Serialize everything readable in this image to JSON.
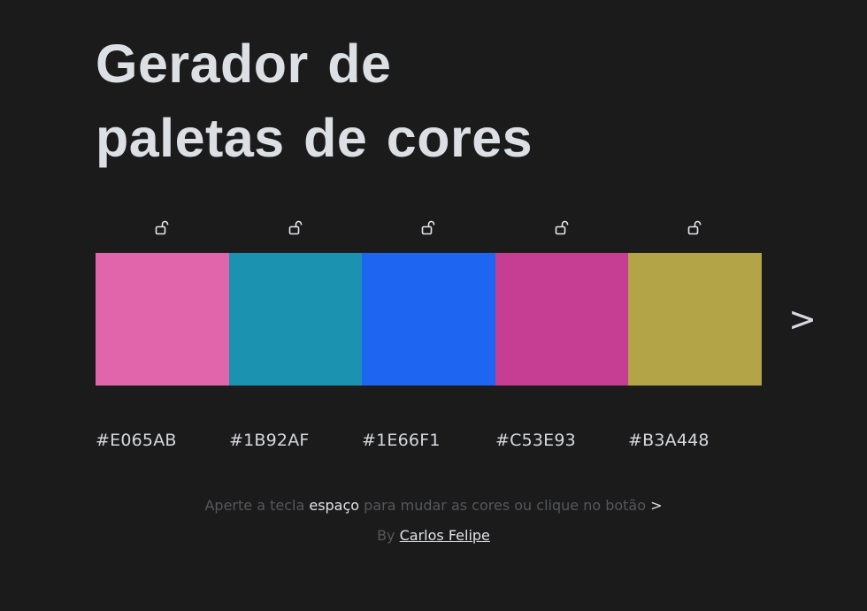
{
  "header": {
    "title_line1": "Gerador de",
    "title_line2": "paletas de cores"
  },
  "palette": {
    "colors": [
      {
        "hex": "#E065AB",
        "locked": false
      },
      {
        "hex": "#1B92AF",
        "locked": false
      },
      {
        "hex": "#1E66F1",
        "locked": false
      },
      {
        "hex": "#C53E93",
        "locked": false
      },
      {
        "hex": "#B3A448",
        "locked": false
      }
    ],
    "lock_icon": "unlocked-padlock-icon",
    "next_label": ">"
  },
  "footer": {
    "hint_part1": "Aperte a tecla",
    "hint_key": "espaço",
    "hint_part2": "para mudar as cores ou clique no botão",
    "hint_button": ">",
    "by_label": "By",
    "author_name": "Carlos Felipe"
  }
}
